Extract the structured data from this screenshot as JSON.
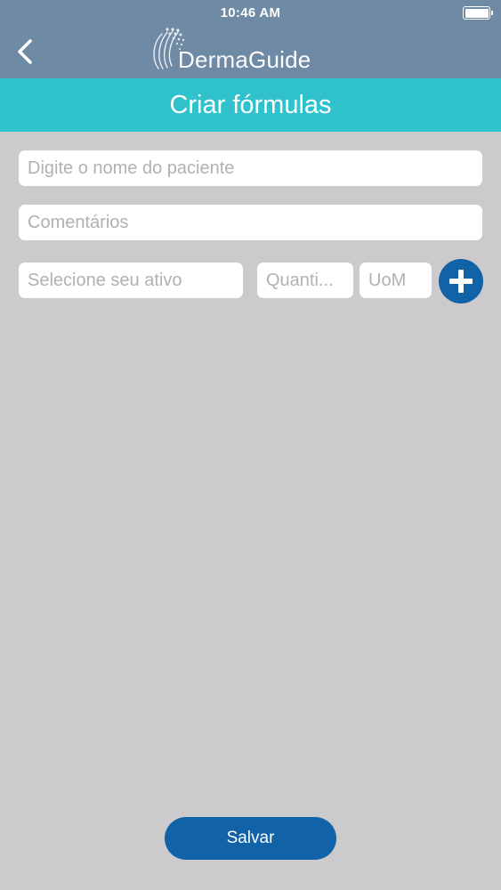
{
  "status_bar": {
    "time": "10:46 AM"
  },
  "nav": {
    "logo_prefix": "Derma",
    "logo_suffix": "Guide"
  },
  "header": {
    "title": "Criar fórmulas"
  },
  "form": {
    "patient_placeholder": "Digite o nome do paciente",
    "comments_placeholder": "Comentários",
    "active_placeholder": "Selecione seu ativo",
    "quantity_placeholder": "Quanti...",
    "uom_placeholder": "UoM"
  },
  "actions": {
    "save_label": "Salvar"
  },
  "colors": {
    "nav_background": "#6e8aa5",
    "title_bar": "#2fc1cc",
    "page_background": "#cbcbcd",
    "primary_button": "#1262a8"
  }
}
